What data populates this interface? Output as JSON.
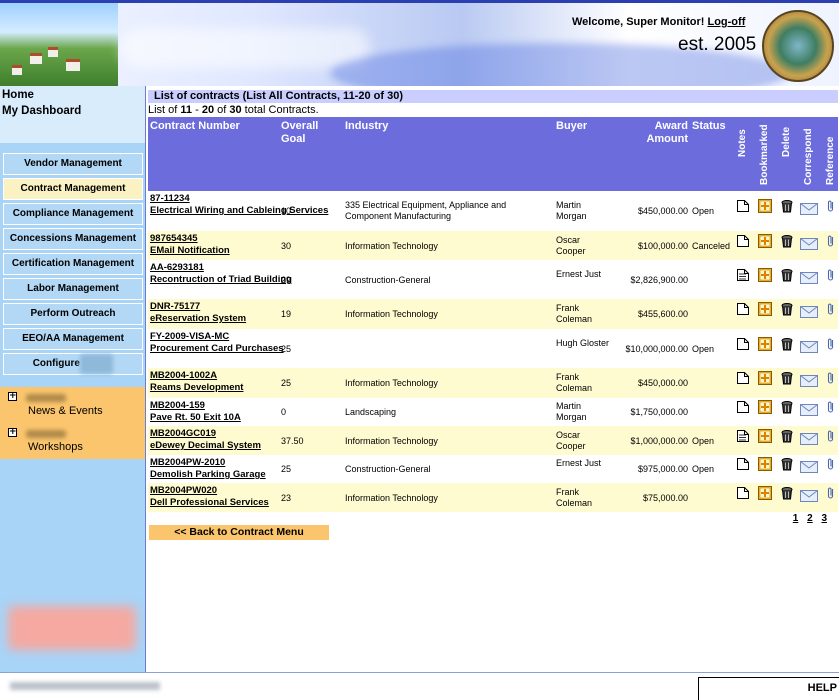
{
  "header": {
    "welcome_prefix": "Welcome, Super Monitor!",
    "logoff_label": "Log-off",
    "established": "est. 2005"
  },
  "sidebar": {
    "home_label": "Home",
    "dashboard_label": "My Dashboard",
    "menu": [
      {
        "label": "Vendor Management",
        "active": false
      },
      {
        "label": "Contract Management",
        "active": true
      },
      {
        "label": "Compliance Management",
        "active": false
      },
      {
        "label": "Concessions Management",
        "active": false
      },
      {
        "label": "Certification Management",
        "active": false
      },
      {
        "label": "Labor Management",
        "active": false
      },
      {
        "label": "Perform Outreach",
        "active": false
      },
      {
        "label": "EEO/AA Management",
        "active": false
      },
      {
        "label": "Configure",
        "active": false
      }
    ],
    "news_label": "News & Events",
    "workshops_label": "Workshops"
  },
  "main": {
    "title": "List of contracts (List All Contracts, 11-20 of 30)",
    "summary_prefix": "List of ",
    "summary_from": "11",
    "summary_dash": " - ",
    "summary_to": "20",
    "summary_of": " of ",
    "summary_total": "30",
    "summary_suffix": " total Contracts.",
    "columns": {
      "contract_number": "Contract Number",
      "overall_goal": "Overall Goal",
      "industry": "Industry",
      "buyer": "Buyer",
      "award_amount": "Award Amount",
      "status": "Status",
      "notes": "Notes",
      "bookmarked": "Bookmarked",
      "delete": "Delete",
      "correspond": "Correspond",
      "reference": "Reference"
    },
    "rows": [
      {
        "num": "87-11234",
        "name": "Electrical Wiring and Cableing Services",
        "goal": "10",
        "industry": "335 Electrical Equipment, Appliance and Component Manufacturing",
        "buyer": "Martin Morgan",
        "amount": "$450,000.00",
        "status": "Open",
        "note_type": "blank"
      },
      {
        "num": "987654345",
        "name": "EMail Notification",
        "goal": "30",
        "industry": "Information Technology",
        "buyer": "Oscar Cooper",
        "amount": "$100,000.00",
        "status": "Canceled",
        "note_type": "blank"
      },
      {
        "num": "AA-6293181",
        "name": "Recontruction of Triad Building",
        "goal": "29",
        "industry": "Construction-General",
        "buyer": "Ernest Just",
        "amount": "$2,826,900.00",
        "status": "",
        "note_type": "text"
      },
      {
        "num": "DNR-75177",
        "name": "eReservation System",
        "goal": "19",
        "industry": "Information Technology",
        "buyer": "Frank Coleman",
        "amount": "$455,600.00",
        "status": "",
        "note_type": "blank"
      },
      {
        "num": "FY-2009-VISA-MC",
        "name": "Procurement Card Purchases",
        "goal": "25",
        "industry": "",
        "buyer": "Hugh Gloster",
        "amount": "$10,000,000.00",
        "status": "Open",
        "note_type": "blank"
      },
      {
        "num": "MB2004-1002A",
        "name": "Reams Development",
        "goal": "25",
        "industry": "Information Technology",
        "buyer": "Frank Coleman",
        "amount": "$450,000.00",
        "status": "",
        "note_type": "blank"
      },
      {
        "num": "MB2004-159",
        "name": "Pave Rt. 50 Exit 10A",
        "goal": "0",
        "industry": "Landscaping",
        "buyer": "Martin Morgan",
        "amount": "$1,750,000.00",
        "status": "",
        "note_type": "blank"
      },
      {
        "num": "MB2004GC019",
        "name": "eDewey Decimal System",
        "goal": "37.50",
        "industry": "Information Technology",
        "buyer": "Oscar Cooper",
        "amount": "$1,000,000.00",
        "status": "Open",
        "note_type": "text"
      },
      {
        "num": "MB2004PW-2010",
        "name": "Demolish Parking Garage",
        "goal": "25",
        "industry": "Construction-General",
        "buyer": "Ernest Just",
        "amount": "$975,000.00",
        "status": "Open",
        "note_type": "blank"
      },
      {
        "num": "MB2004PW020",
        "name": "Dell Professional Services",
        "goal": "23",
        "industry": "Information Technology",
        "buyer": "Frank Coleman",
        "amount": "$75,000.00",
        "status": "",
        "note_type": "blank"
      }
    ],
    "pages": [
      "1",
      "2",
      "3"
    ],
    "back_label": "<< Back to Contract Menu"
  },
  "footer": {
    "help_label": "HELP"
  },
  "icons": {
    "notes_blank": "document-icon",
    "notes_text": "document-text-icon",
    "bookmark": "bookmark-plus-icon",
    "delete": "trash-icon",
    "correspond": "envelope-icon",
    "reference": "paperclip-icon"
  },
  "colors": {
    "header_band": "#6c6cdc",
    "title_bar": "#c9ceff",
    "sidebar": "#a8d4f7",
    "active_menu": "#fbf2c4",
    "row_alt": "#fffbd0",
    "accent_orange": "#fac56d"
  }
}
